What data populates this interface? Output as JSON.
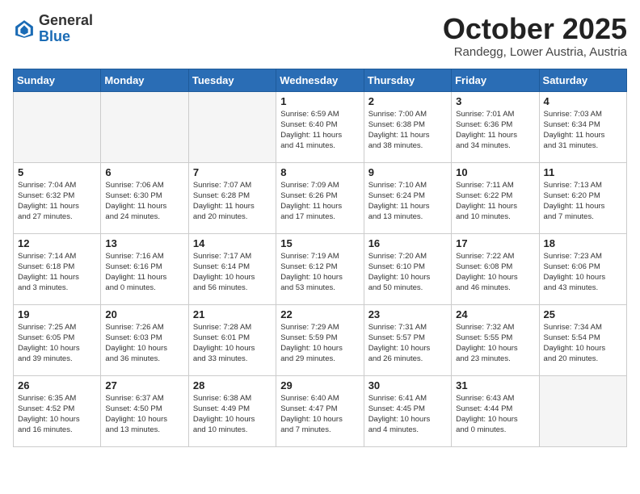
{
  "header": {
    "logo_general": "General",
    "logo_blue": "Blue",
    "month_title": "October 2025",
    "location": "Randegg, Lower Austria, Austria"
  },
  "days_of_week": [
    "Sunday",
    "Monday",
    "Tuesday",
    "Wednesday",
    "Thursday",
    "Friday",
    "Saturday"
  ],
  "weeks": [
    [
      {
        "day": "",
        "info": ""
      },
      {
        "day": "",
        "info": ""
      },
      {
        "day": "",
        "info": ""
      },
      {
        "day": "1",
        "info": "Sunrise: 6:59 AM\nSunset: 6:40 PM\nDaylight: 11 hours\nand 41 minutes."
      },
      {
        "day": "2",
        "info": "Sunrise: 7:00 AM\nSunset: 6:38 PM\nDaylight: 11 hours\nand 38 minutes."
      },
      {
        "day": "3",
        "info": "Sunrise: 7:01 AM\nSunset: 6:36 PM\nDaylight: 11 hours\nand 34 minutes."
      },
      {
        "day": "4",
        "info": "Sunrise: 7:03 AM\nSunset: 6:34 PM\nDaylight: 11 hours\nand 31 minutes."
      }
    ],
    [
      {
        "day": "5",
        "info": "Sunrise: 7:04 AM\nSunset: 6:32 PM\nDaylight: 11 hours\nand 27 minutes."
      },
      {
        "day": "6",
        "info": "Sunrise: 7:06 AM\nSunset: 6:30 PM\nDaylight: 11 hours\nand 24 minutes."
      },
      {
        "day": "7",
        "info": "Sunrise: 7:07 AM\nSunset: 6:28 PM\nDaylight: 11 hours\nand 20 minutes."
      },
      {
        "day": "8",
        "info": "Sunrise: 7:09 AM\nSunset: 6:26 PM\nDaylight: 11 hours\nand 17 minutes."
      },
      {
        "day": "9",
        "info": "Sunrise: 7:10 AM\nSunset: 6:24 PM\nDaylight: 11 hours\nand 13 minutes."
      },
      {
        "day": "10",
        "info": "Sunrise: 7:11 AM\nSunset: 6:22 PM\nDaylight: 11 hours\nand 10 minutes."
      },
      {
        "day": "11",
        "info": "Sunrise: 7:13 AM\nSunset: 6:20 PM\nDaylight: 11 hours\nand 7 minutes."
      }
    ],
    [
      {
        "day": "12",
        "info": "Sunrise: 7:14 AM\nSunset: 6:18 PM\nDaylight: 11 hours\nand 3 minutes."
      },
      {
        "day": "13",
        "info": "Sunrise: 7:16 AM\nSunset: 6:16 PM\nDaylight: 11 hours\nand 0 minutes."
      },
      {
        "day": "14",
        "info": "Sunrise: 7:17 AM\nSunset: 6:14 PM\nDaylight: 10 hours\nand 56 minutes."
      },
      {
        "day": "15",
        "info": "Sunrise: 7:19 AM\nSunset: 6:12 PM\nDaylight: 10 hours\nand 53 minutes."
      },
      {
        "day": "16",
        "info": "Sunrise: 7:20 AM\nSunset: 6:10 PM\nDaylight: 10 hours\nand 50 minutes."
      },
      {
        "day": "17",
        "info": "Sunrise: 7:22 AM\nSunset: 6:08 PM\nDaylight: 10 hours\nand 46 minutes."
      },
      {
        "day": "18",
        "info": "Sunrise: 7:23 AM\nSunset: 6:06 PM\nDaylight: 10 hours\nand 43 minutes."
      }
    ],
    [
      {
        "day": "19",
        "info": "Sunrise: 7:25 AM\nSunset: 6:05 PM\nDaylight: 10 hours\nand 39 minutes."
      },
      {
        "day": "20",
        "info": "Sunrise: 7:26 AM\nSunset: 6:03 PM\nDaylight: 10 hours\nand 36 minutes."
      },
      {
        "day": "21",
        "info": "Sunrise: 7:28 AM\nSunset: 6:01 PM\nDaylight: 10 hours\nand 33 minutes."
      },
      {
        "day": "22",
        "info": "Sunrise: 7:29 AM\nSunset: 5:59 PM\nDaylight: 10 hours\nand 29 minutes."
      },
      {
        "day": "23",
        "info": "Sunrise: 7:31 AM\nSunset: 5:57 PM\nDaylight: 10 hours\nand 26 minutes."
      },
      {
        "day": "24",
        "info": "Sunrise: 7:32 AM\nSunset: 5:55 PM\nDaylight: 10 hours\nand 23 minutes."
      },
      {
        "day": "25",
        "info": "Sunrise: 7:34 AM\nSunset: 5:54 PM\nDaylight: 10 hours\nand 20 minutes."
      }
    ],
    [
      {
        "day": "26",
        "info": "Sunrise: 6:35 AM\nSunset: 4:52 PM\nDaylight: 10 hours\nand 16 minutes."
      },
      {
        "day": "27",
        "info": "Sunrise: 6:37 AM\nSunset: 4:50 PM\nDaylight: 10 hours\nand 13 minutes."
      },
      {
        "day": "28",
        "info": "Sunrise: 6:38 AM\nSunset: 4:49 PM\nDaylight: 10 hours\nand 10 minutes."
      },
      {
        "day": "29",
        "info": "Sunrise: 6:40 AM\nSunset: 4:47 PM\nDaylight: 10 hours\nand 7 minutes."
      },
      {
        "day": "30",
        "info": "Sunrise: 6:41 AM\nSunset: 4:45 PM\nDaylight: 10 hours\nand 4 minutes."
      },
      {
        "day": "31",
        "info": "Sunrise: 6:43 AM\nSunset: 4:44 PM\nDaylight: 10 hours\nand 0 minutes."
      },
      {
        "day": "",
        "info": ""
      }
    ]
  ]
}
